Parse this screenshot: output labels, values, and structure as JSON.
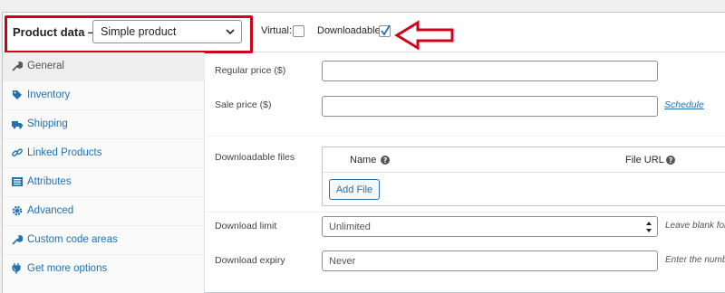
{
  "header": {
    "product_data_label": "Product data —",
    "product_type": "Simple product",
    "virtual_label": "Virtual:",
    "virtual_checked": false,
    "downloadable_label": "Downloadable:",
    "downloadable_checked": true
  },
  "sidebar": {
    "items": [
      {
        "label": "General",
        "icon": "wrench-icon",
        "active": true
      },
      {
        "label": "Inventory",
        "icon": "tag-icon",
        "active": false
      },
      {
        "label": "Shipping",
        "icon": "truck-icon",
        "active": false
      },
      {
        "label": "Linked Products",
        "icon": "link-icon",
        "active": false
      },
      {
        "label": "Attributes",
        "icon": "list-icon",
        "active": false
      },
      {
        "label": "Advanced",
        "icon": "gear-icon",
        "active": false
      },
      {
        "label": "Custom code areas",
        "icon": "wrench-icon",
        "active": false
      },
      {
        "label": "Get more options",
        "icon": "plugin-icon",
        "active": false
      }
    ]
  },
  "general": {
    "regular_price_label": "Regular price ($)",
    "regular_price_value": "",
    "sale_price_label": "Sale price ($)",
    "sale_price_value": "",
    "schedule_link": "Schedule",
    "downloadable_files_label": "Downloadable files",
    "files_columns": {
      "name": "Name",
      "file_url": "File URL"
    },
    "add_file_button": "Add File",
    "download_limit_label": "Download limit",
    "download_limit_placeholder": "Unlimited",
    "download_limit_hint": "Leave blank for",
    "download_expiry_label": "Download expiry",
    "download_expiry_placeholder": "Never",
    "download_expiry_hint": "Enter the numb"
  },
  "colors": {
    "highlight": "#d0021b",
    "link": "#2271b1",
    "checkbox_check": "#2271b1"
  }
}
